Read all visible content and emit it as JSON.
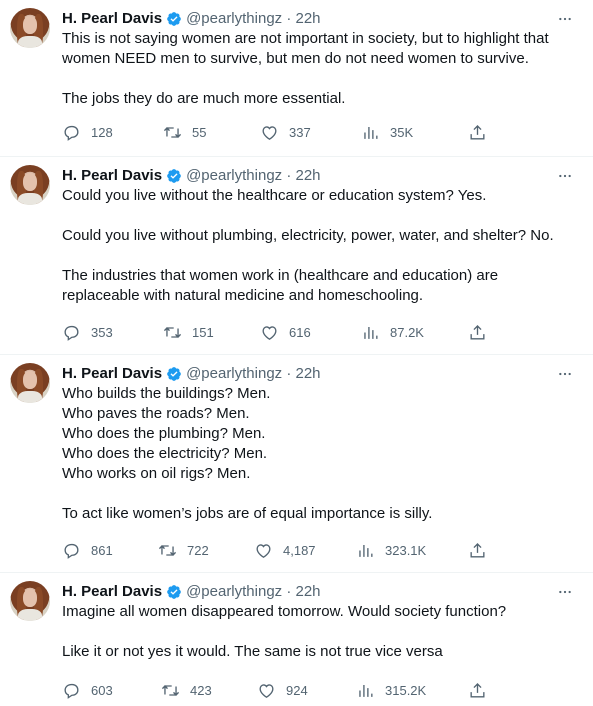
{
  "tweets": [
    {
      "author": "H. Pearl Davis",
      "handle": "@pearlythingz · 22h",
      "lines": [
        "This is not saying women are not important in society, but to highlight that",
        "women NEED men to survive, but men do not need women to survive.",
        "",
        "The jobs they do are much more essential."
      ],
      "replies": "128",
      "retweets": "55",
      "likes": "337",
      "views": "35K"
    },
    {
      "author": "H. Pearl Davis",
      "handle": "@pearlythingz · 22h",
      "lines": [
        "Could you live without the healthcare or education system? Yes.",
        "",
        "Could you live without plumbing, electricity, power, water, and shelter? No.",
        "",
        "The industries that women work in (healthcare and education) are",
        "replaceable with natural medicine and homeschooling."
      ],
      "replies": "353",
      "retweets": "151",
      "likes": "616",
      "views": "87.2K"
    },
    {
      "author": "H. Pearl Davis",
      "handle": "@pearlythingz · 22h",
      "lines": [
        "Who builds the buildings? Men.",
        "Who paves the roads? Men.",
        "Who does the plumbing? Men.",
        "Who does the electricity? Men.",
        "Who works on oil rigs? Men.",
        "",
        "To act like women’s jobs are of equal importance is silly."
      ],
      "replies": "861",
      "retweets": "722",
      "likes": "4,187",
      "views": "323.1K"
    },
    {
      "author": "H. Pearl Davis",
      "handle": "@pearlythingz · 22h",
      "lines": [
        "Imagine all women disappeared tomorrow. Would society function?",
        "",
        "Like it or not yes it would. The same is not true vice versa"
      ],
      "replies": "603",
      "retweets": "423",
      "likes": "924",
      "views": "315.2K"
    }
  ],
  "colors": {
    "text": "#0f1419",
    "secondary": "#536471",
    "verified": "#1d9bf0",
    "divider": "#eff3f4"
  }
}
